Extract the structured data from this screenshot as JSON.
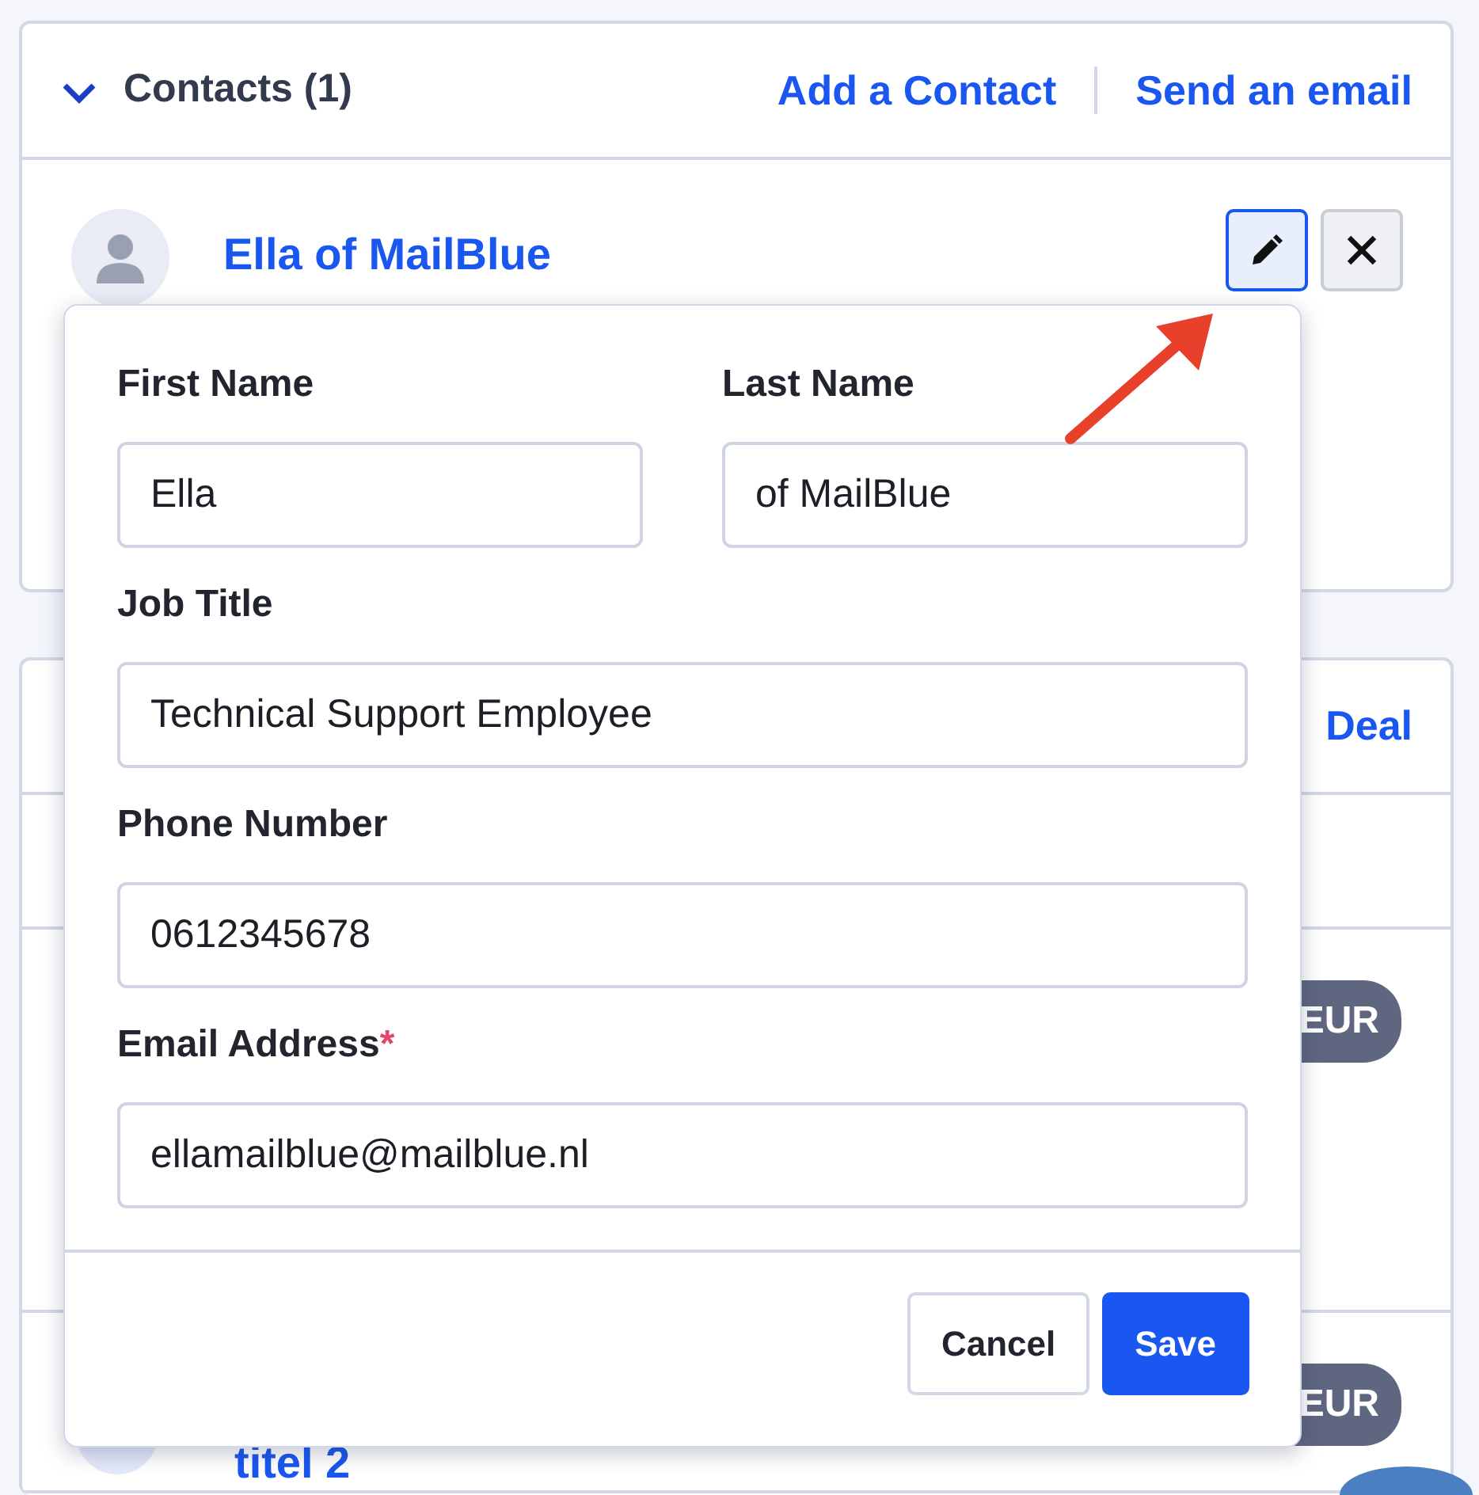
{
  "contacts": {
    "title": "Contacts (1)",
    "expanded": true,
    "actions": [
      "Add a Contact",
      "Send an email"
    ],
    "items": [
      {
        "name": "Ella of MailBlue",
        "editing": true
      }
    ]
  },
  "edit_form": {
    "rows": [
      [
        {
          "label": "First Name",
          "value": "Ella"
        },
        {
          "label": "Last Name",
          "value": "of MailBlue"
        }
      ],
      [
        {
          "label": "Job Title",
          "value": "Technical Support Employee"
        }
      ],
      [
        {
          "label": "Phone Number",
          "value": "0612345678"
        }
      ],
      [
        {
          "label": "Email Address",
          "value": "ellamailblue@mailblue.nl",
          "required_mark": "*"
        }
      ]
    ],
    "buttons": [
      {
        "label": "Cancel",
        "kind": "secondary"
      },
      {
        "label": "Save",
        "kind": "primary"
      }
    ]
  },
  "deals": {
    "header_action": "Deal",
    "rows": [
      {
        "badge": "EUR"
      },
      {
        "badge": "EUR",
        "title": "titel 2"
      }
    ]
  }
}
